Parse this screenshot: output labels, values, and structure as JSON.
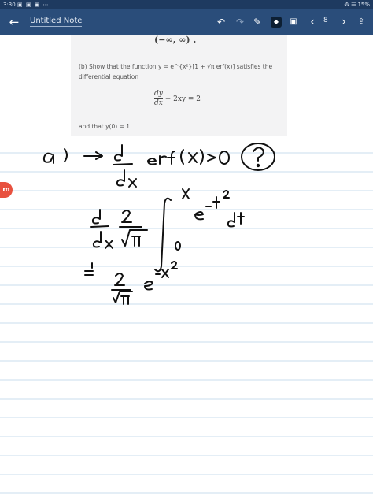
{
  "status_bar": {
    "time": "3:30",
    "left_icons": "▣ ▣ ▣ ⋯",
    "right": "⁂ 𝄚 15%"
  },
  "app_bar": {
    "back_icon": "←",
    "title": "Untitled Note",
    "tools": {
      "undo": "↶",
      "redo": "↷",
      "pen": "✎",
      "eraser": "◆",
      "image": "▣",
      "prev": "‹",
      "page": "8",
      "next": "›",
      "share": "⇪"
    }
  },
  "note": {
    "fragment_top": "(−∞, ∞) .",
    "question_part": "(b) Show that the function y = e^{x²}[1 + √π erf(x)] satisfies the differential equation",
    "equation_num": "dy",
    "equation_den": "dx",
    "equation_rest": "− 2xy = 2",
    "condition": "and that y(0) = 1."
  },
  "badge": "m"
}
